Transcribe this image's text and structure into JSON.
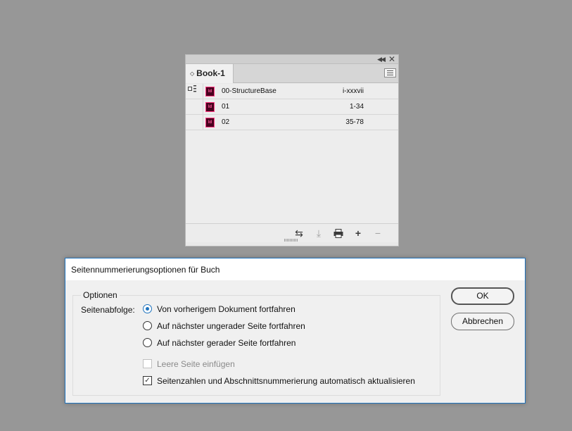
{
  "book_panel": {
    "tab_title": "Book-1",
    "rows": [
      {
        "name": "00-StructureBase",
        "pages": "i-xxxvii"
      },
      {
        "name": "01",
        "pages": "1-34"
      },
      {
        "name": "02",
        "pages": "35-78"
      }
    ],
    "file_icon_text": "Id",
    "colors": {
      "indesign_icon": "#49021f",
      "indesign_icon_border": "#ff3c84"
    },
    "icons": {
      "collapse": "double-chevron-left-icon",
      "close": "close-icon",
      "tab_updown": "up-down-arrow-icon",
      "menu": "panel-menu-icon",
      "row_marker": "style-source-icon",
      "synchronize": "synchronize-icon",
      "save": "save-icon",
      "print": "print-icon",
      "add": "plus-icon",
      "remove": "minus-icon"
    }
  },
  "dialog": {
    "title": "Seitennummerierungsoptionen für Buch",
    "group_label": "Optionen",
    "sequence_label": "Seitenabfolge:",
    "radios": [
      {
        "label": "Von vorherigem Dokument fortfahren",
        "checked": true
      },
      {
        "label": "Auf nächster ungerader Seite fortfahren",
        "checked": false
      },
      {
        "label": "Auf nächster gerader Seite fortfahren",
        "checked": false
      }
    ],
    "checkbox_blank_page": {
      "label": "Leere Seite einfügen",
      "checked": false,
      "enabled": false
    },
    "checkbox_auto_update": {
      "label": "Seitenzahlen und Abschnittsnummerierung automatisch aktualisieren",
      "checked": true,
      "enabled": true
    },
    "ok_label": "OK",
    "cancel_label": "Abbrechen",
    "colors": {
      "accent": "#1e73be"
    }
  }
}
